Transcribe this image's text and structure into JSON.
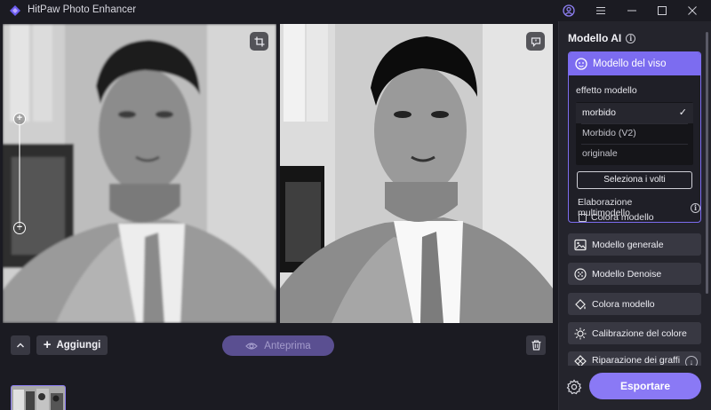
{
  "app": {
    "title": "HitPaw Photo Enhancer",
    "accent_color": "#7c6cf0",
    "icons": [
      "hitpaw-logo-icon",
      "account-icon",
      "menu-icon",
      "minimize-icon",
      "maximize-icon",
      "close-icon"
    ]
  },
  "canvas": {
    "left_pane": {
      "icons": [
        "crop-icon",
        "zoom-in-icon",
        "zoom-out-icon"
      ]
    },
    "right_pane": {
      "icons": [
        "feedback-icon"
      ]
    }
  },
  "toolbar": {
    "add_label": "Aggiungi",
    "preview_label": "Anteprima",
    "icons": [
      "chevron-up-icon",
      "plus-icon",
      "eye-icon",
      "trash-icon"
    ]
  },
  "panel": {
    "heading": "Modello AI",
    "face_model": {
      "title": "Modello del viso",
      "effect_label": "effetto modello",
      "options": [
        {
          "label": "morbido",
          "selected": true
        },
        {
          "label": "Morbido (V2)",
          "selected": false
        },
        {
          "label": "originale",
          "selected": false
        }
      ],
      "select_faces_label": "Seleziona i volti",
      "multi_model_label": "Elaborazione multimodello",
      "color_model_checkbox": "Colora modello"
    },
    "models": [
      {
        "label": "Modello generale",
        "icon": "image-icon"
      },
      {
        "label": "Modello Denoise",
        "icon": "denoise-icon"
      },
      {
        "label": "Colora modello",
        "icon": "paint-bucket-icon"
      },
      {
        "label": "Calibrazione del colore",
        "icon": "sun-icon"
      },
      {
        "label": "Riparazione dei graffi",
        "icon": "scratch-repair-icon"
      }
    ],
    "export_label": "Esportare"
  }
}
